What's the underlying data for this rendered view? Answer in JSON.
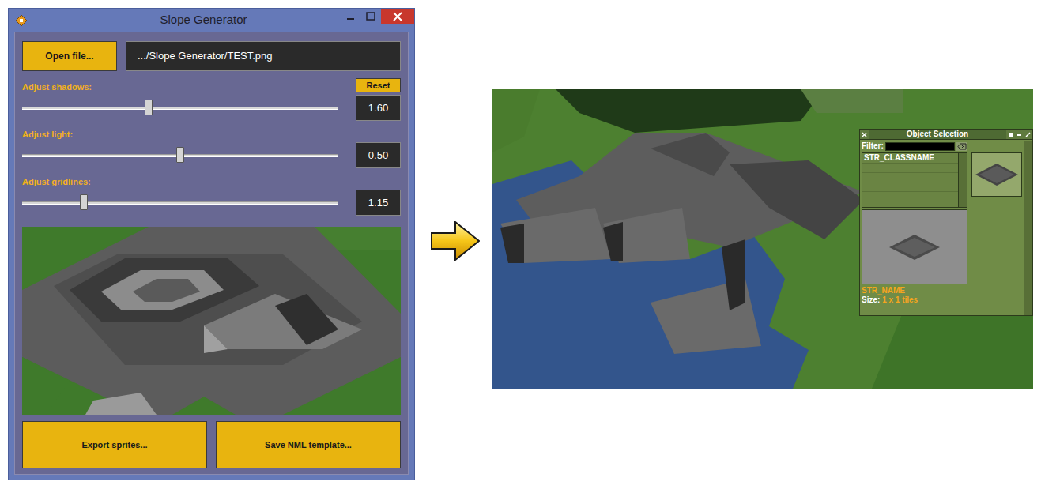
{
  "window": {
    "title": "Slope Generator"
  },
  "file": {
    "button": "Open file...",
    "path": ".../Slope Generator/TEST.png"
  },
  "reset_button": "Reset",
  "sliders": [
    {
      "label": "Adjust shadows:",
      "level": 0.4,
      "reading": "1.60"
    },
    {
      "label": "Adjust light:",
      "level": 0.5,
      "reading": "0.50"
    },
    {
      "label": "Adjust gridlines:",
      "level": 0.195,
      "reading": "1.15"
    }
  ],
  "actions": [
    "Export sprites...",
    "Save NML template..."
  ],
  "game_window": {
    "title": "Object Selection",
    "filter": {
      "label": "Filter:",
      "value": ""
    },
    "classes": [
      {
        "name": "STR_CLASSNAME",
        "selected": true
      }
    ],
    "object_name": "STR_NAME",
    "size": {
      "label": "Size:",
      "value": "1 x 1 tiles"
    }
  }
}
